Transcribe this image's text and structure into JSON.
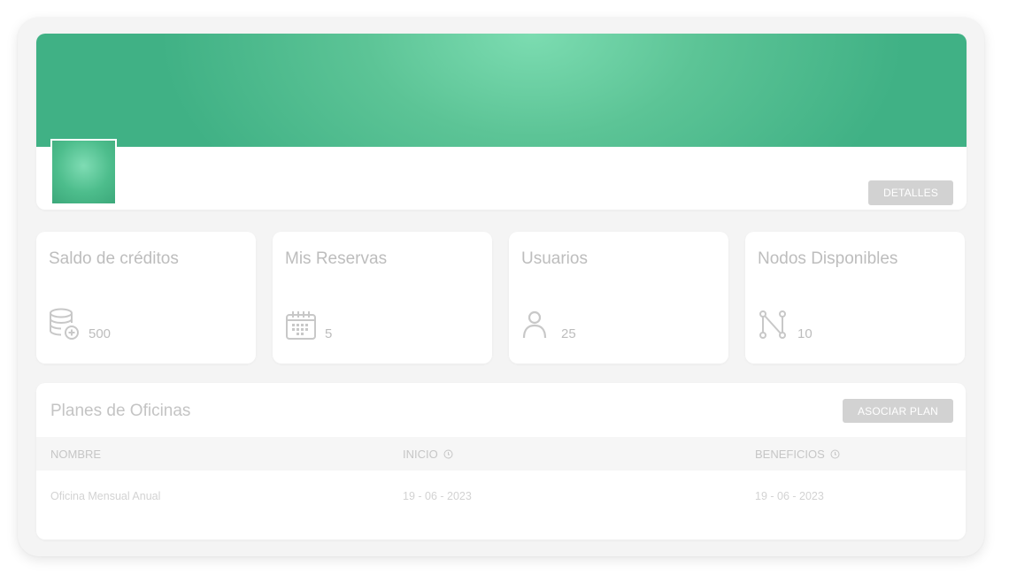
{
  "profile": {
    "details_button": "DETALLES"
  },
  "stats": [
    {
      "title": "Saldo de créditos",
      "value": "500",
      "icon": "coins-stack-plus-icon"
    },
    {
      "title": "Mis Reservas",
      "value": "5",
      "icon": "calendar-icon"
    },
    {
      "title": "Usuarios",
      "value": "25",
      "icon": "user-icon"
    },
    {
      "title": "Nodos Disponibles",
      "value": "10",
      "icon": "nodes-icon"
    }
  ],
  "plans": {
    "title": "Planes de Oficinas",
    "associate_button": "ASOCIAR PLAN",
    "columns": [
      "NOMBRE",
      "INICIO",
      "BENEFICIOS"
    ],
    "rows": [
      [
        "Oficina Mensual Anual",
        "19 - 06 - 2023",
        "19 - 06 - 2023"
      ]
    ]
  },
  "colors": {
    "brand_green": "#40b185",
    "brand_green_light": "#7cdcb1",
    "button_grey": "#d2d2d2",
    "muted_text": "#bdbdbd"
  }
}
